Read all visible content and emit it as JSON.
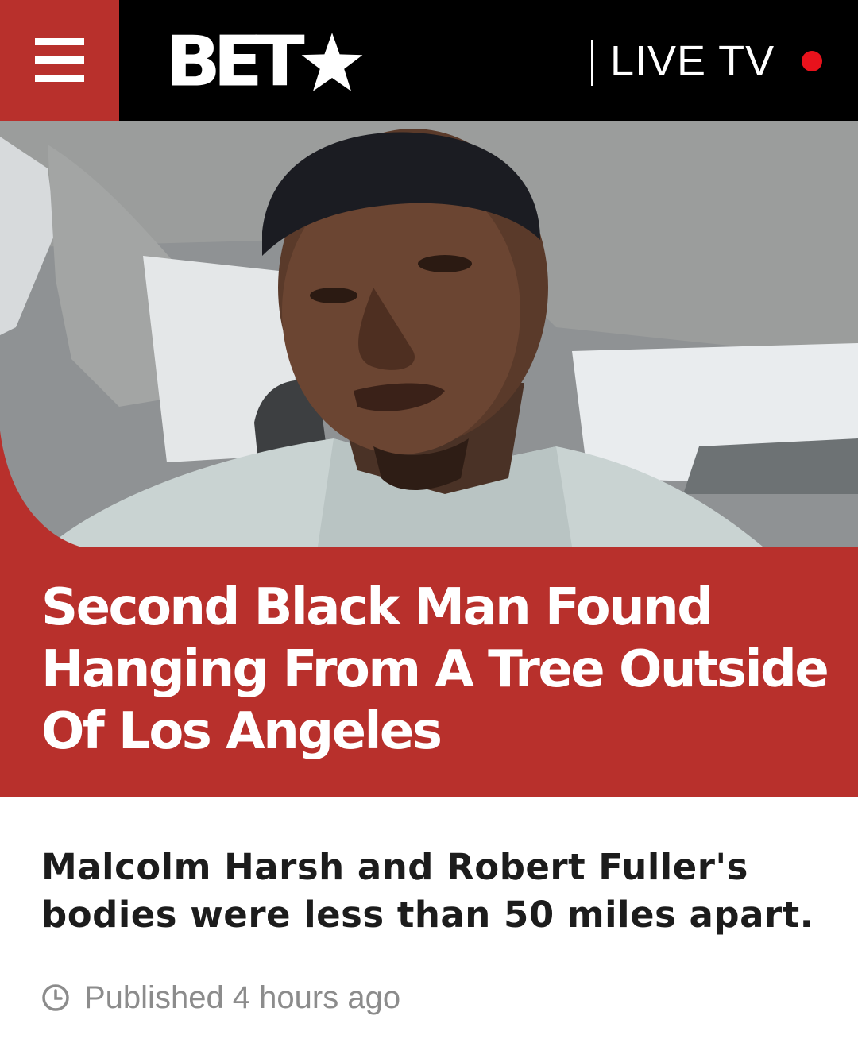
{
  "colors": {
    "brand_red": "#b8302c",
    "header_bg": "#000000",
    "live_dot": "#e8121c",
    "headline_text": "#ffffff",
    "subhead_text": "#1c1c1c",
    "meta_text": "#8c8c8c"
  },
  "header": {
    "menu_icon": "hamburger-menu-icon",
    "logo_text": "BET",
    "logo_icon": "star-icon",
    "live_tv_label": "LIVE TV",
    "live_indicator_icon": "red-dot-icon"
  },
  "hero": {
    "image_subject": "photo"
  },
  "article": {
    "headline": "Second Black Man Found Hanging From A Tree Outside Of Los Angeles",
    "subhead": "Malcolm Harsh and Robert Fuller's bodies were less than 50 miles apart.",
    "published_icon": "clock-icon",
    "published": "Published 4 hours ago"
  }
}
